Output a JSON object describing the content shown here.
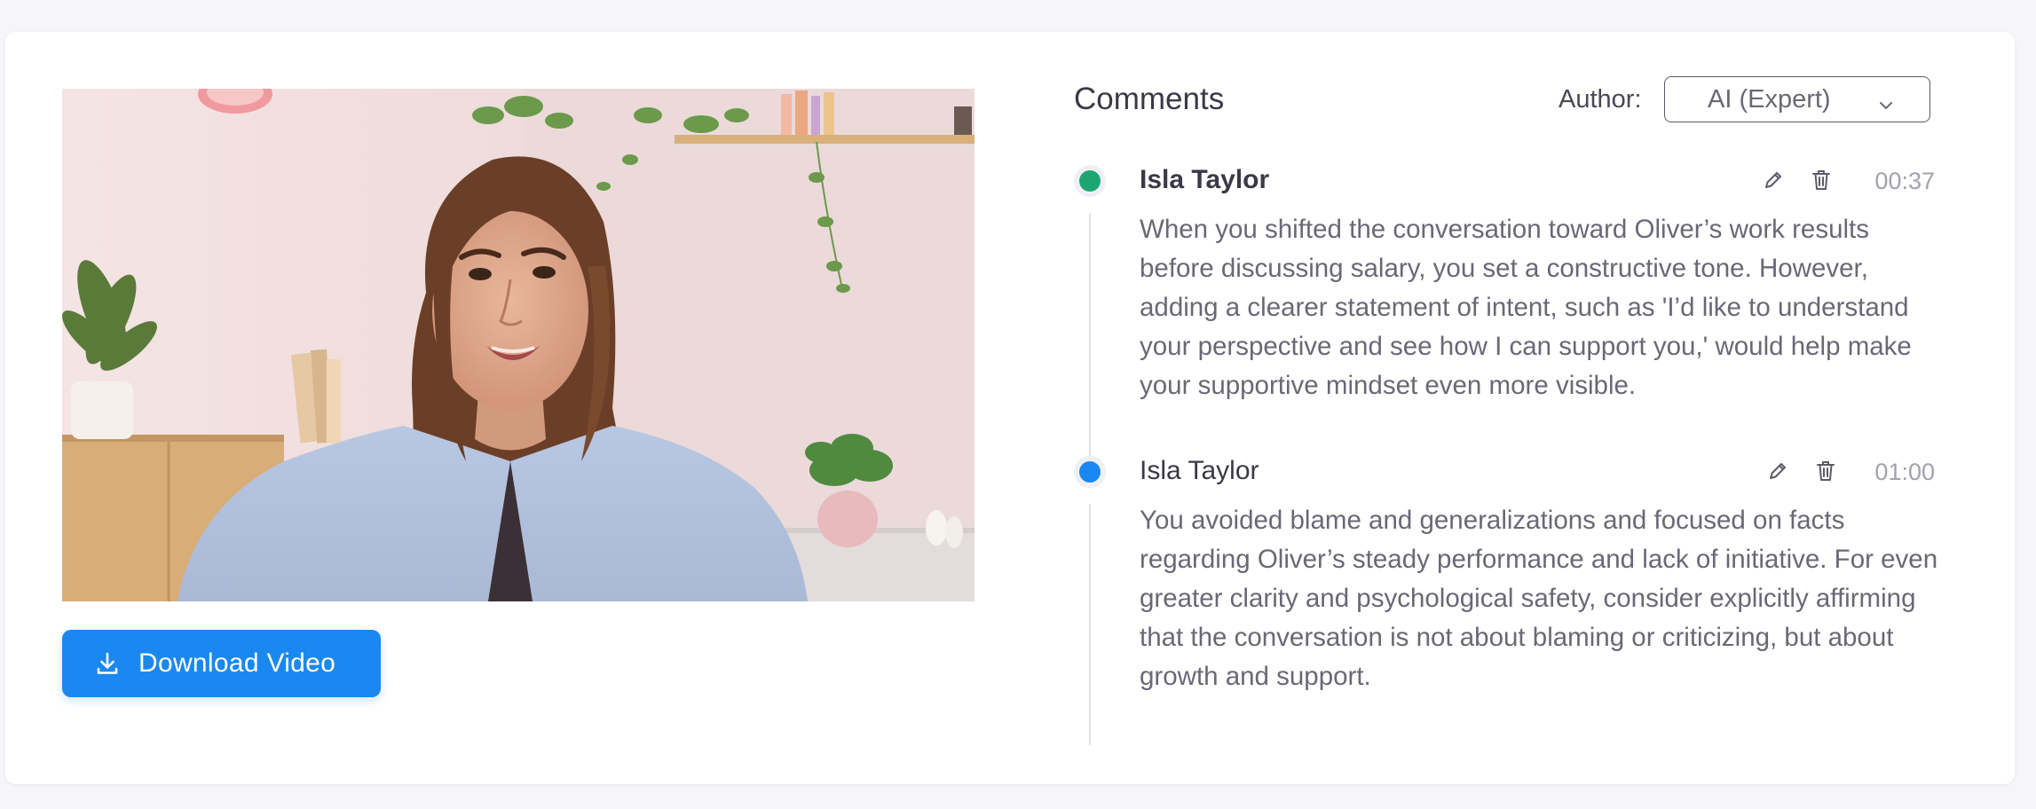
{
  "video": {
    "download_label": "Download Video"
  },
  "comments_panel": {
    "title": "Comments",
    "author_filter": {
      "label": "Author:",
      "selected": "AI (Expert)"
    },
    "items": [
      {
        "author": "Isla Taylor",
        "timestamp": "00:37",
        "status_color": "#1ea672",
        "text": "When you shifted the conversation toward Oliver’s work results before discussing salary, you set a constructive tone. However, adding a clearer statement of intent, such as 'I’d like to understand your perspective and see how I can support you,' would help make your supportive mindset even more visible."
      },
      {
        "author": "Isla Taylor",
        "timestamp": "01:00",
        "status_color": "#1a88f0",
        "text": "You avoided blame and generalizations and focused on facts regarding Oliver’s steady performance and lack of initiative. For even greater clarity and psychological safety, consider explicitly affirming that the conversation is not about blaming or criticizing, but about growth and support."
      }
    ]
  },
  "colors": {
    "accent": "#1a88f0",
    "card_bg": "#ffffff",
    "page_bg": "#f6f5f9"
  },
  "icons": {
    "download": "download-icon",
    "edit": "pencil-icon",
    "delete": "trash-icon",
    "dropdown": "chevron-down-icon"
  }
}
